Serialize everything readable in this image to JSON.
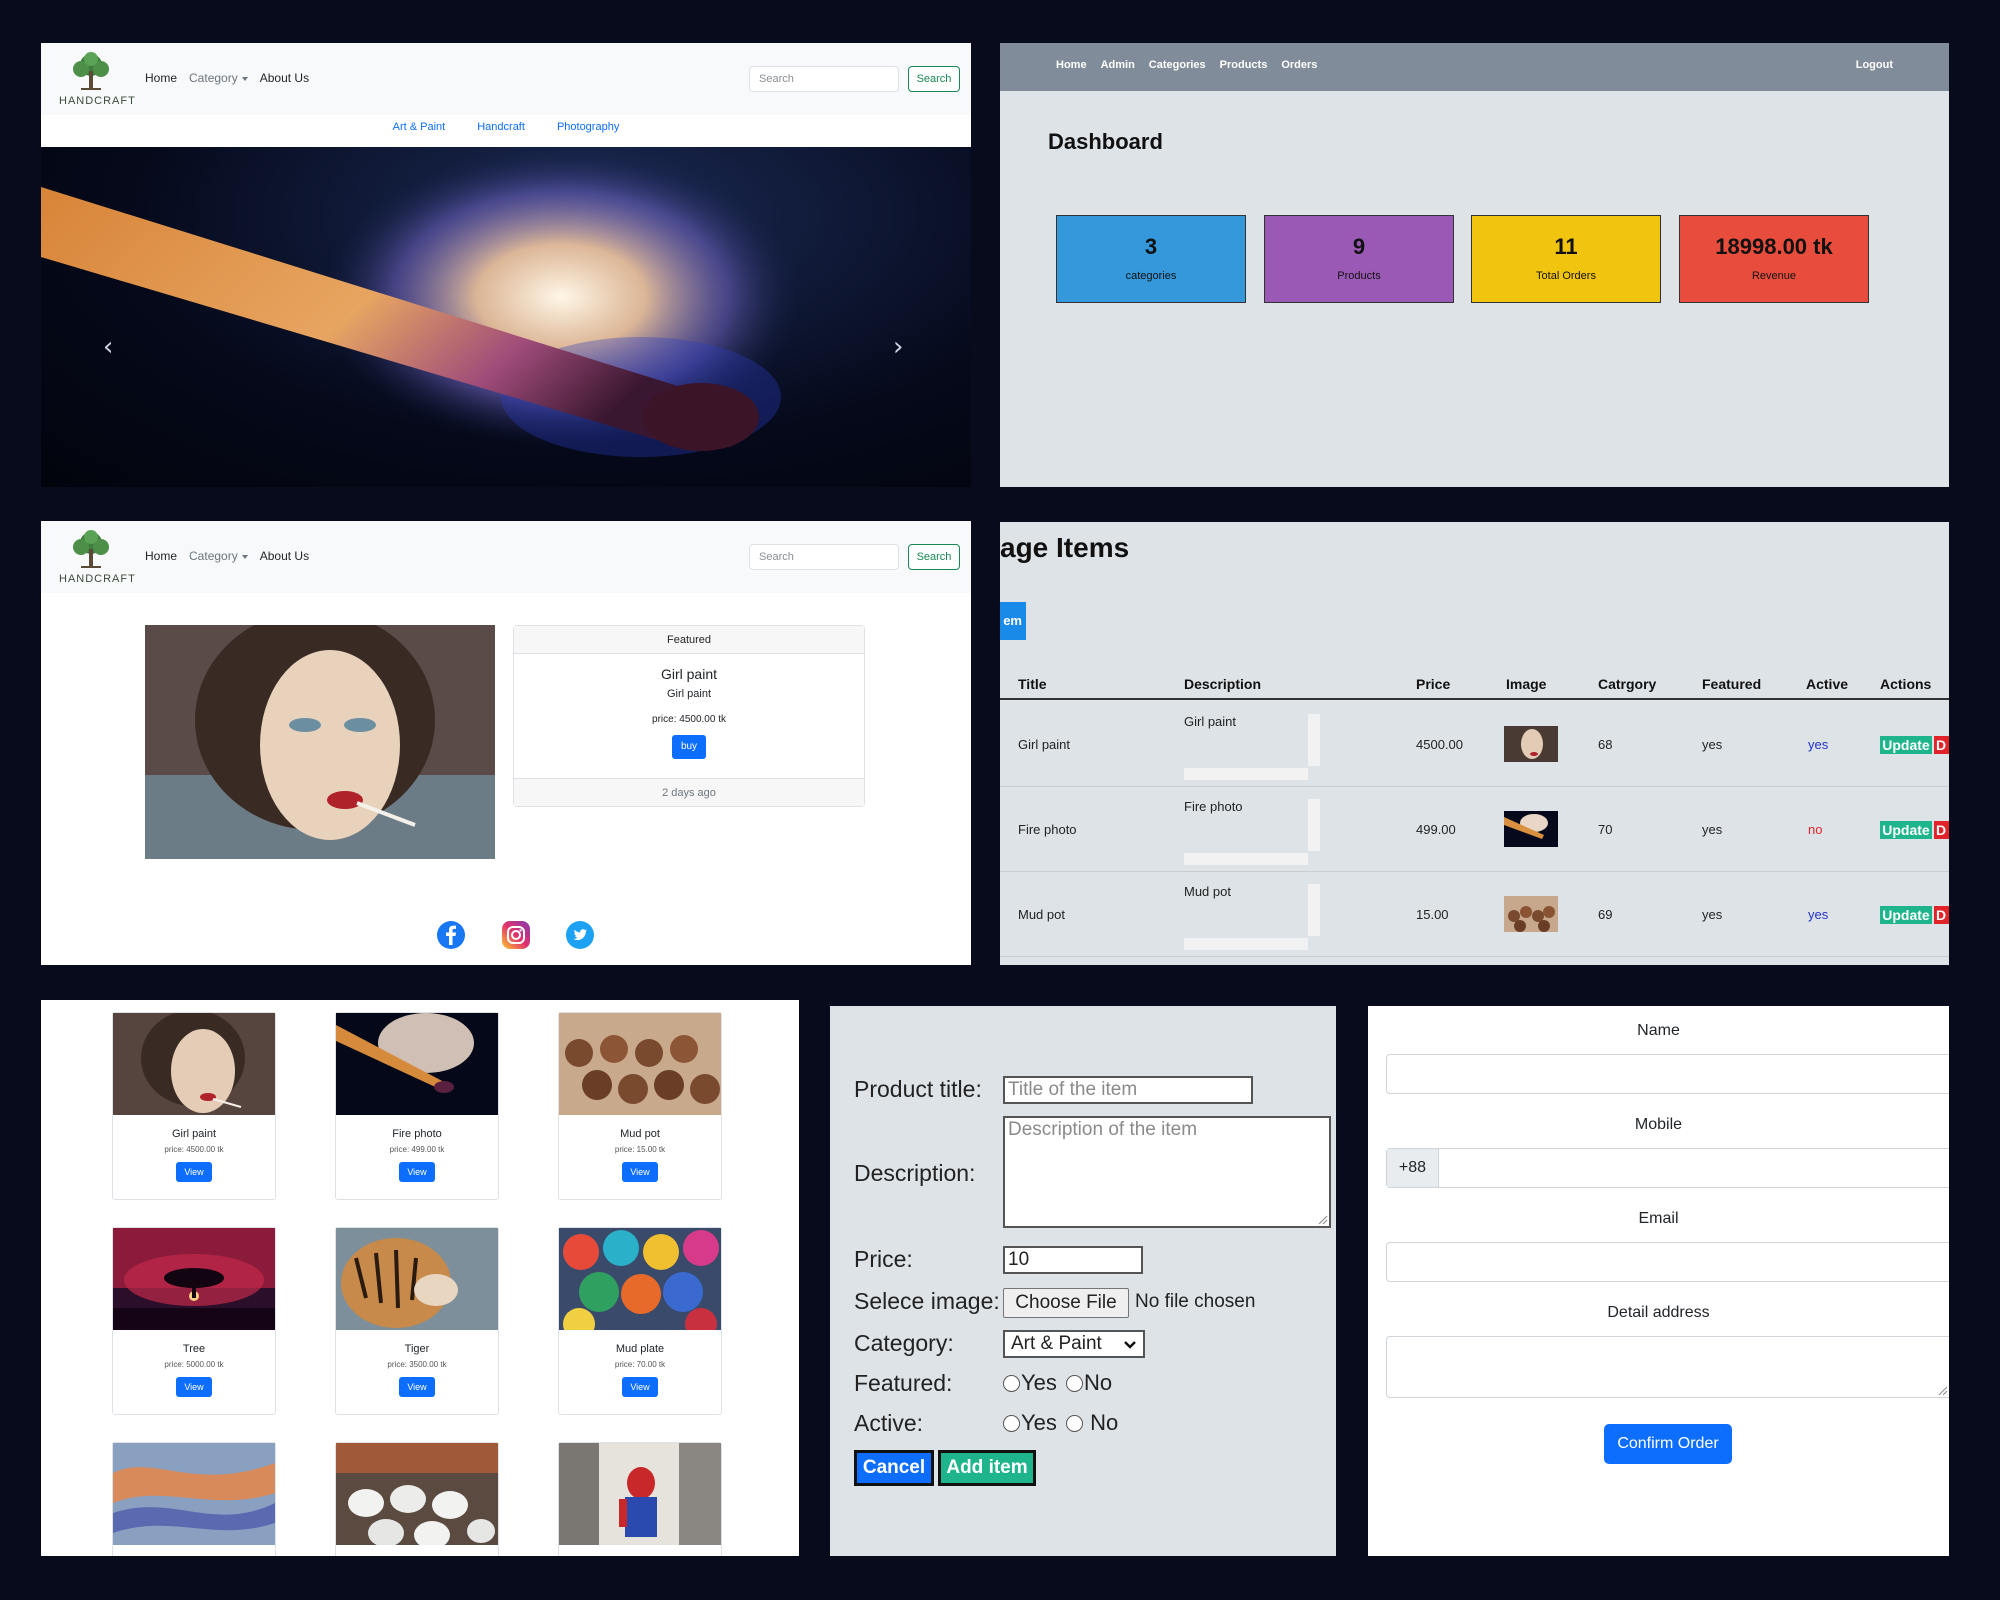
{
  "storefront": {
    "logo_text": "HANDCRAFT",
    "nav": [
      "Home",
      "Category",
      "About Us"
    ],
    "search_placeholder": "Search",
    "search_button": "Search",
    "subcategories": [
      "Art & Paint",
      "Handcraft",
      "Photography"
    ]
  },
  "dashboard": {
    "nav": [
      "Home",
      "Admin",
      "Categories",
      "Products",
      "Orders"
    ],
    "logout": "Logout",
    "title": "Dashboard",
    "cards": [
      {
        "value": "3",
        "label": "categories",
        "color": "#3498db"
      },
      {
        "value": "9",
        "label": "Products",
        "color": "#9b59b6"
      },
      {
        "value": "11",
        "label": "Total Orders",
        "color": "#f1c40f"
      },
      {
        "value": "18998.00 tk",
        "label": "Revenue",
        "color": "#e74c3c"
      }
    ]
  },
  "detail": {
    "featured_label": "Featured",
    "title": "Girl paint",
    "subtitle": "Girl paint",
    "price": "price: 4500.00 tk",
    "buy": "buy",
    "posted": "2 days ago"
  },
  "manage": {
    "title": "age Items",
    "add_button": "em",
    "headers": [
      "Title",
      "Description",
      "Price",
      "Image",
      "Catrgory",
      "Featured",
      "Active",
      "Actions"
    ],
    "rows": [
      {
        "title": "Girl paint",
        "description": "Girl paint",
        "price": "4500.00",
        "category": "68",
        "featured": "yes",
        "active": "yes"
      },
      {
        "title": "Fire photo",
        "description": "Fire photo",
        "price": "499.00",
        "category": "70",
        "featured": "yes",
        "active": "no"
      },
      {
        "title": "Mud pot",
        "description": "Mud pot",
        "price": "15.00",
        "category": "69",
        "featured": "yes",
        "active": "yes"
      }
    ],
    "update": "Update",
    "delete": "D"
  },
  "grid": {
    "items": [
      {
        "title": "Girl paint",
        "price": "price: 4500.00 tk"
      },
      {
        "title": "Fire photo",
        "price": "price: 499.00 tk"
      },
      {
        "title": "Mud pot",
        "price": "price: 15.00 tk"
      },
      {
        "title": "Tree",
        "price": "price: 5000.00 tk"
      },
      {
        "title": "Tiger",
        "price": "price: 3500.00 tk"
      },
      {
        "title": "Mud plate",
        "price": "price: 70.00 tk"
      }
    ],
    "view": "View"
  },
  "addform": {
    "labels": {
      "title": "Product title:",
      "description": "Description:",
      "price": "Price:",
      "image": "Selece image:",
      "category": "Category:",
      "featured": "Featured:",
      "active": "Active:"
    },
    "title_placeholder": "Title of the item",
    "description_placeholder": "Description of the item",
    "price_value": "10",
    "choose_file": "Choose File",
    "no_file": "No file chosen",
    "category_selected": "Art & Paint",
    "yes": "Yes",
    "no": "No",
    "cancel": "Cancel",
    "add": "Add item"
  },
  "order": {
    "name_label": "Name",
    "mobile_label": "Mobile",
    "mobile_prefix": "+88",
    "email_label": "Email",
    "address_label": "Detail address",
    "confirm": "Confirm Order"
  }
}
